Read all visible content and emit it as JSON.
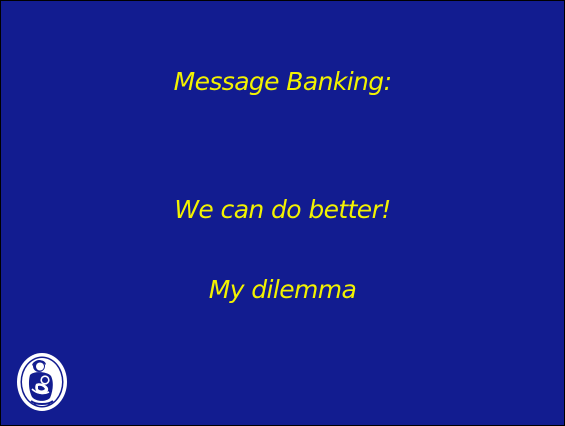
{
  "slide": {
    "background_color": "#121c90",
    "text_color": "#f2f200",
    "lines": [
      "Message Banking:",
      "We can do better!",
      "My dilemma"
    ],
    "logo_icon": "mother-and-child-emblem-icon"
  }
}
